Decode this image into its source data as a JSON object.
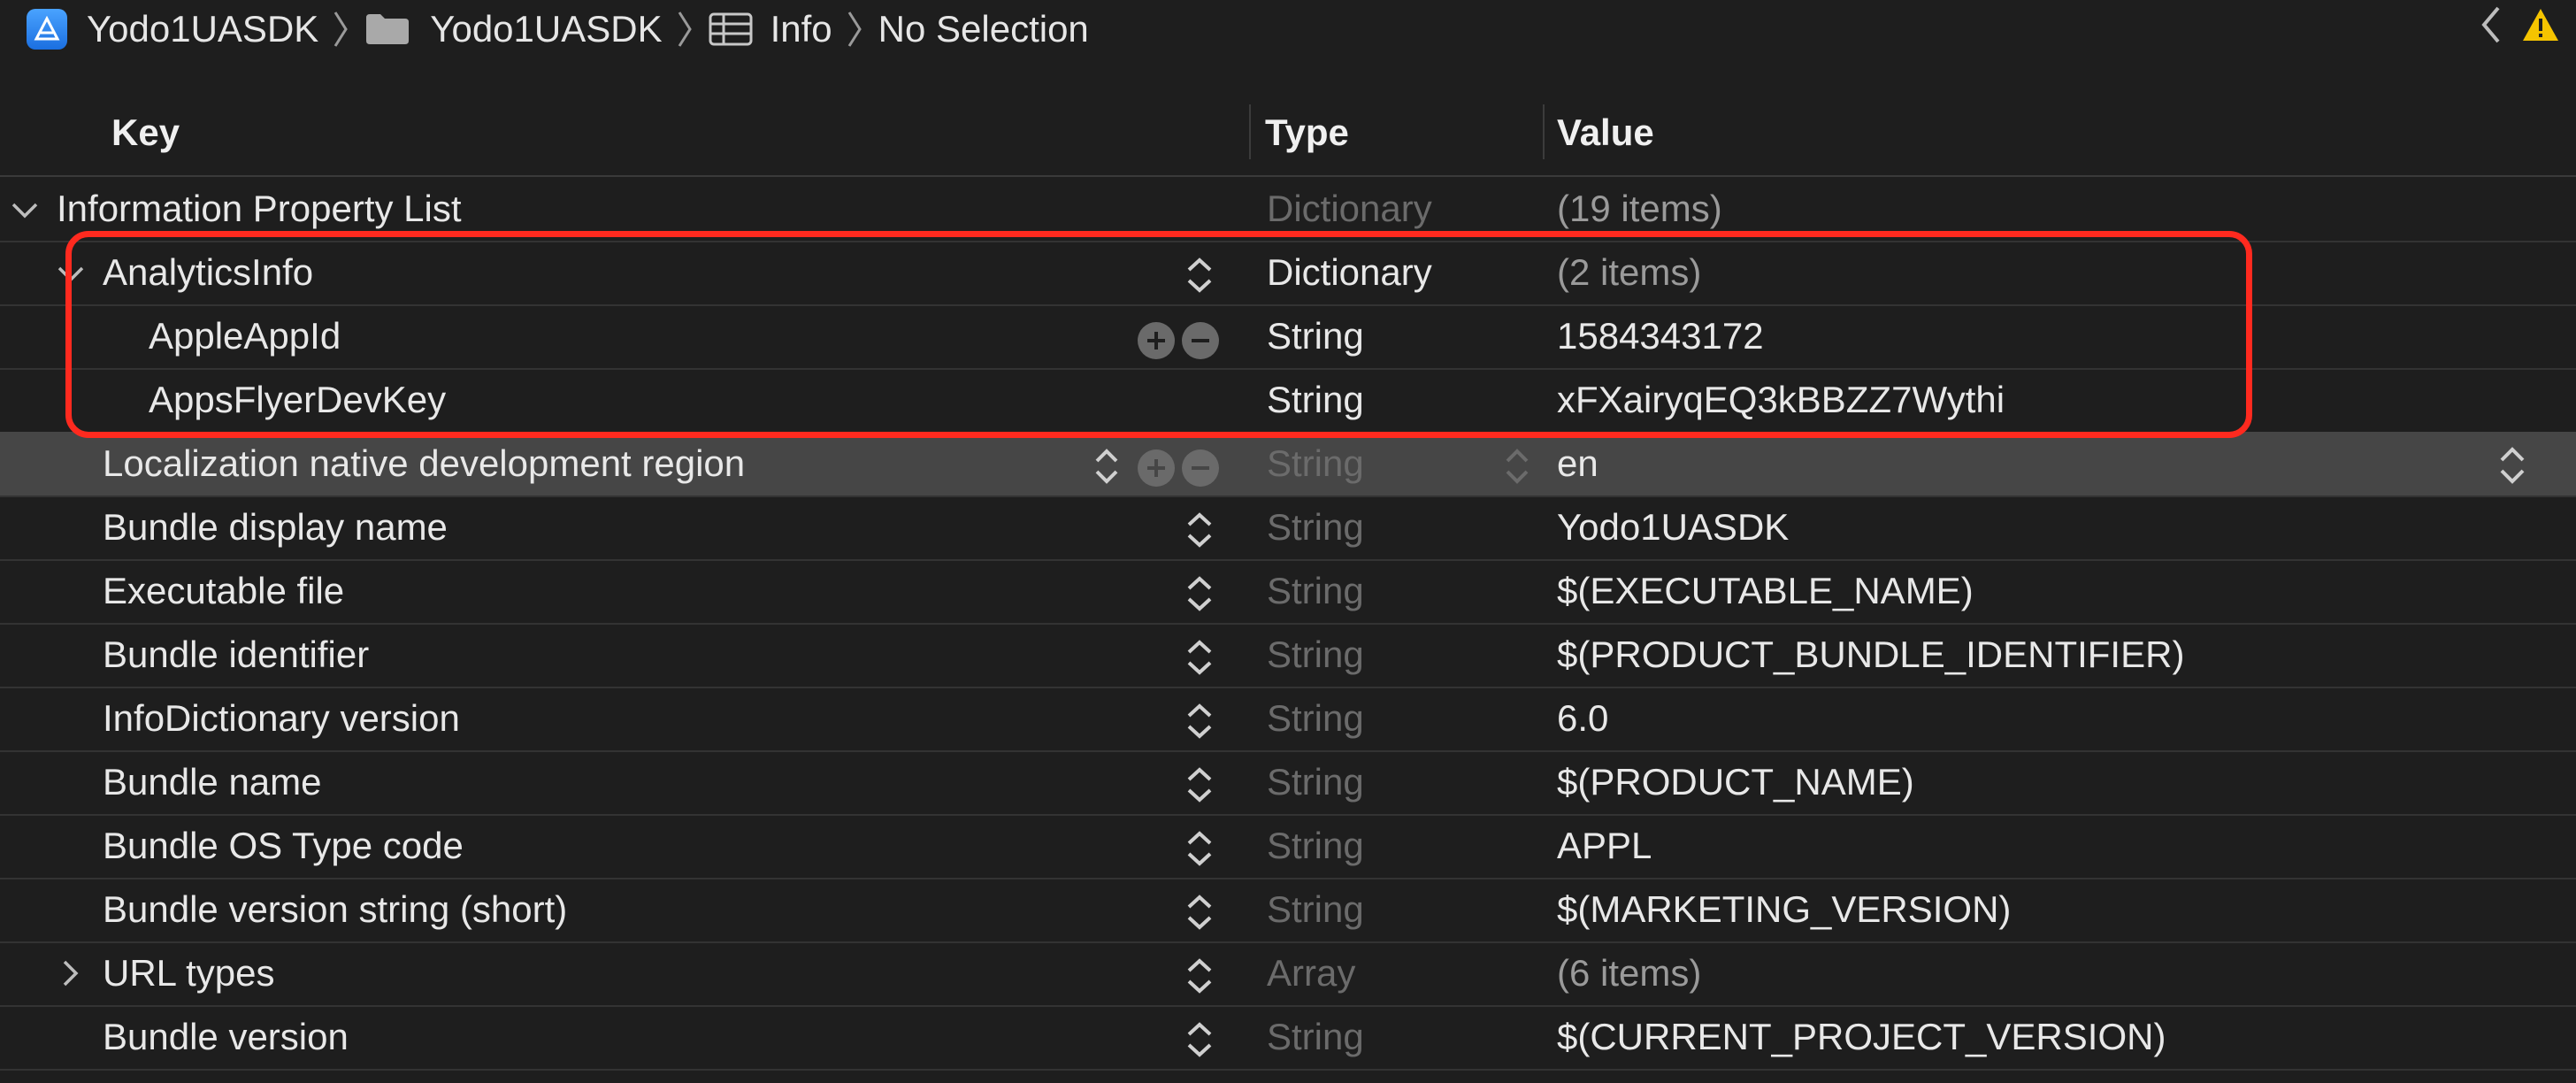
{
  "breadcrumb": {
    "project": "Yodo1UASDK",
    "folder": "Yodo1UASDK",
    "file": "Info",
    "selection": "No Selection"
  },
  "columns": {
    "key": "Key",
    "type": "Type",
    "value": "Value"
  },
  "rows": [
    {
      "key": "Information Property List",
      "type": "Dictionary",
      "value": "(19 items)"
    },
    {
      "key": "AnalyticsInfo",
      "type": "Dictionary",
      "value": "(2 items)"
    },
    {
      "key": "AppleAppId",
      "type": "String",
      "value": "1584343172"
    },
    {
      "key": "AppsFlyerDevKey",
      "type": "String",
      "value": "xFXairyqEQ3kBBZZ7Wythi"
    },
    {
      "key": "Localization native development region",
      "type": "String",
      "value": "en"
    },
    {
      "key": "Bundle display name",
      "type": "String",
      "value": "Yodo1UASDK"
    },
    {
      "key": "Executable file",
      "type": "String",
      "value": "$(EXECUTABLE_NAME)"
    },
    {
      "key": "Bundle identifier",
      "type": "String",
      "value": "$(PRODUCT_BUNDLE_IDENTIFIER)"
    },
    {
      "key": "InfoDictionary version",
      "type": "String",
      "value": "6.0"
    },
    {
      "key": "Bundle name",
      "type": "String",
      "value": "$(PRODUCT_NAME)"
    },
    {
      "key": "Bundle OS Type code",
      "type": "String",
      "value": "APPL"
    },
    {
      "key": "Bundle version string (short)",
      "type": "String",
      "value": "$(MARKETING_VERSION)"
    },
    {
      "key": "URL types",
      "type": "Array",
      "value": "(6 items)"
    },
    {
      "key": "Bundle version",
      "type": "String",
      "value": "$(CURRENT_PROJECT_VERSION)"
    }
  ],
  "colors": {
    "background": "#1e1e1e",
    "selected_row": "#464646",
    "highlight": "#ff2a1f",
    "warning": "#f5c400"
  },
  "icons": [
    "xcode-project-icon",
    "folder-icon",
    "plist-icon",
    "chevron-right-icon",
    "back-icon",
    "warning-icon",
    "disclosure-icon",
    "stepper-icon",
    "add-icon",
    "remove-icon"
  ]
}
